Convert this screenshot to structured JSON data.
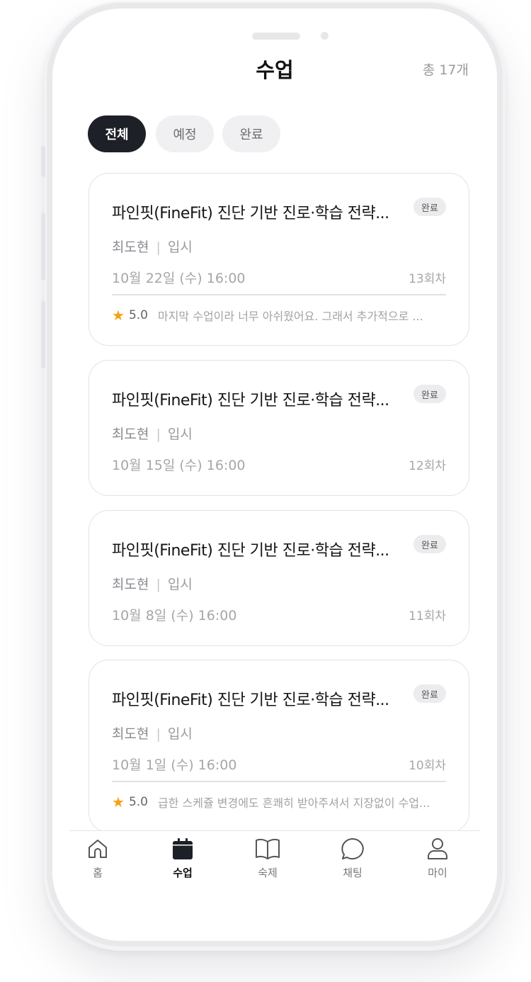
{
  "header": {
    "title": "수업",
    "total": "총 17개"
  },
  "filters": [
    {
      "label": "전체",
      "active": true
    },
    {
      "label": "예정",
      "active": false
    },
    {
      "label": "완료",
      "active": false
    }
  ],
  "lessons": [
    {
      "title": "파인핏(FineFit) 진단 기반 진로·학습 전략...",
      "badge": "완료",
      "teacher": "최도현",
      "category": "입시",
      "date": "10월 22일 (수) 16:00",
      "session": "13회차",
      "rating": "5.0",
      "review": "마지막 수업이라 너무 아쉬웠어요. 그래서 추가적으로 ..."
    },
    {
      "title": "파인핏(FineFit) 진단 기반 진로·학습 전략...",
      "badge": "완료",
      "teacher": "최도현",
      "category": "입시",
      "date": "10월 15일 (수) 16:00",
      "session": "12회차"
    },
    {
      "title": "파인핏(FineFit) 진단 기반 진로·학습 전략...",
      "badge": "완료",
      "teacher": "최도현",
      "category": "입시",
      "date": "10월 8일 (수) 16:00",
      "session": "11회차"
    },
    {
      "title": "파인핏(FineFit) 진단 기반 진로·학습 전략...",
      "badge": "완료",
      "teacher": "최도현",
      "category": "입시",
      "date": "10월 1일 (수) 16:00",
      "session": "10회차",
      "rating": "5.0",
      "review": "급한 스케쥴 변경에도 흔쾌히 받아주셔서 지장없이 수업..."
    }
  ],
  "tabs": [
    {
      "label": "홈",
      "icon": "home-icon",
      "active": false
    },
    {
      "label": "수업",
      "icon": "calendar-icon",
      "active": true
    },
    {
      "label": "숙제",
      "icon": "book-icon",
      "active": false
    },
    {
      "label": "채팅",
      "icon": "chat-icon",
      "active": false
    },
    {
      "label": "마이",
      "icon": "user-icon",
      "active": false
    }
  ],
  "colors": {
    "accent": "#1d2027",
    "star": "#f5a112",
    "chip_bg": "#f0f0f2"
  }
}
